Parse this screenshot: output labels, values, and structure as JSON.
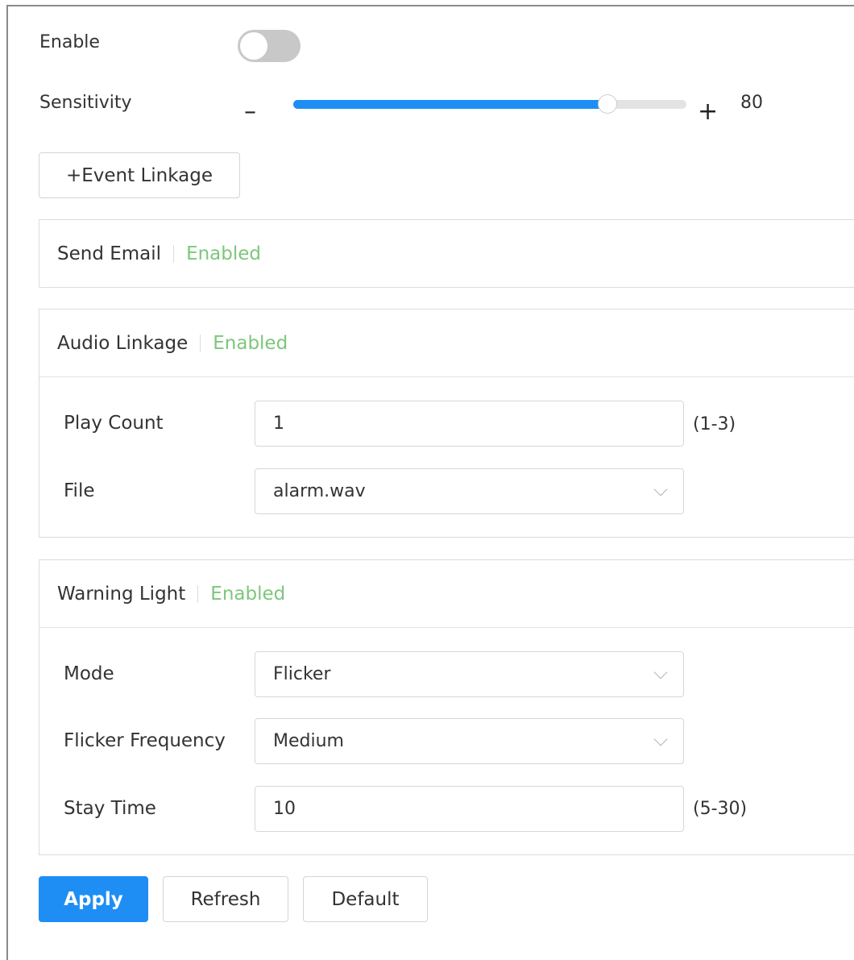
{
  "enable": {
    "label": "Enable",
    "on": false
  },
  "sensitivity": {
    "label": "Sensitivity",
    "minus": "–",
    "plus": "+",
    "value": 80,
    "value_text": "80",
    "max": 100
  },
  "event_linkage_button": "+Event Linkage",
  "send_email": {
    "title": "Send Email",
    "status": "Enabled"
  },
  "audio_linkage": {
    "title": "Audio Linkage",
    "status": "Enabled",
    "play_count": {
      "label": "Play Count",
      "value": "1",
      "range": "(1-3)"
    },
    "file": {
      "label": "File",
      "value": "alarm.wav"
    }
  },
  "warning_light": {
    "title": "Warning Light",
    "status": "Enabled",
    "mode": {
      "label": "Mode",
      "value": "Flicker"
    },
    "flicker_frequency": {
      "label": "Flicker Frequency",
      "value": "Medium"
    },
    "stay_time": {
      "label": "Stay Time",
      "value": "10",
      "range": "(5-30)"
    }
  },
  "actions": {
    "apply": "Apply",
    "refresh": "Refresh",
    "default": "Default"
  },
  "colors": {
    "accent": "#1e8ef5",
    "enabled_text": "#7cc77a",
    "toggle_off": "#c8c8c8"
  }
}
